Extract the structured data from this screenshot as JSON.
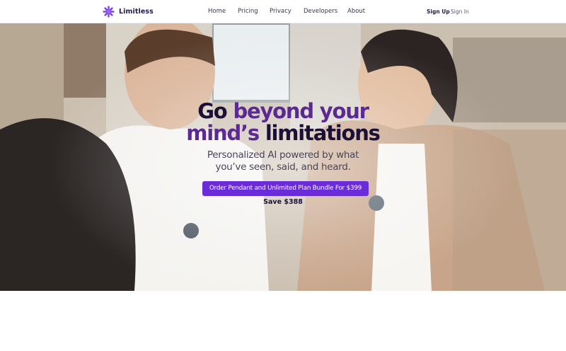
{
  "brand": {
    "name": "Limitless",
    "logo_icon": "limitless-asterisk-icon",
    "accent_color": "#7b3fe4"
  },
  "nav": {
    "items": [
      {
        "label": "Home"
      },
      {
        "label": "Pricing"
      },
      {
        "label": "Privacy"
      },
      {
        "label": "Developers"
      },
      {
        "label": "About"
      }
    ]
  },
  "auth": {
    "sign_up": "Sign Up",
    "sign_in": "Sign In"
  },
  "hero": {
    "headline_line1_part1": "Go ",
    "headline_line1_part2": "beyond your",
    "headline_line2_part1": "mind’s ",
    "headline_line2_part2": "limitations",
    "subheadline_line1": "Personalized AI powered by what",
    "subheadline_line2": "you’ve seen, said, and heard.",
    "cta_label": "Order Pendant and Unlimited Plan Bundle For $399",
    "savings_text": "Save $388",
    "cta_color": "#6a2bd8",
    "headline_dark_color": "#1b1136",
    "headline_purple_color": "#5b2a90"
  }
}
